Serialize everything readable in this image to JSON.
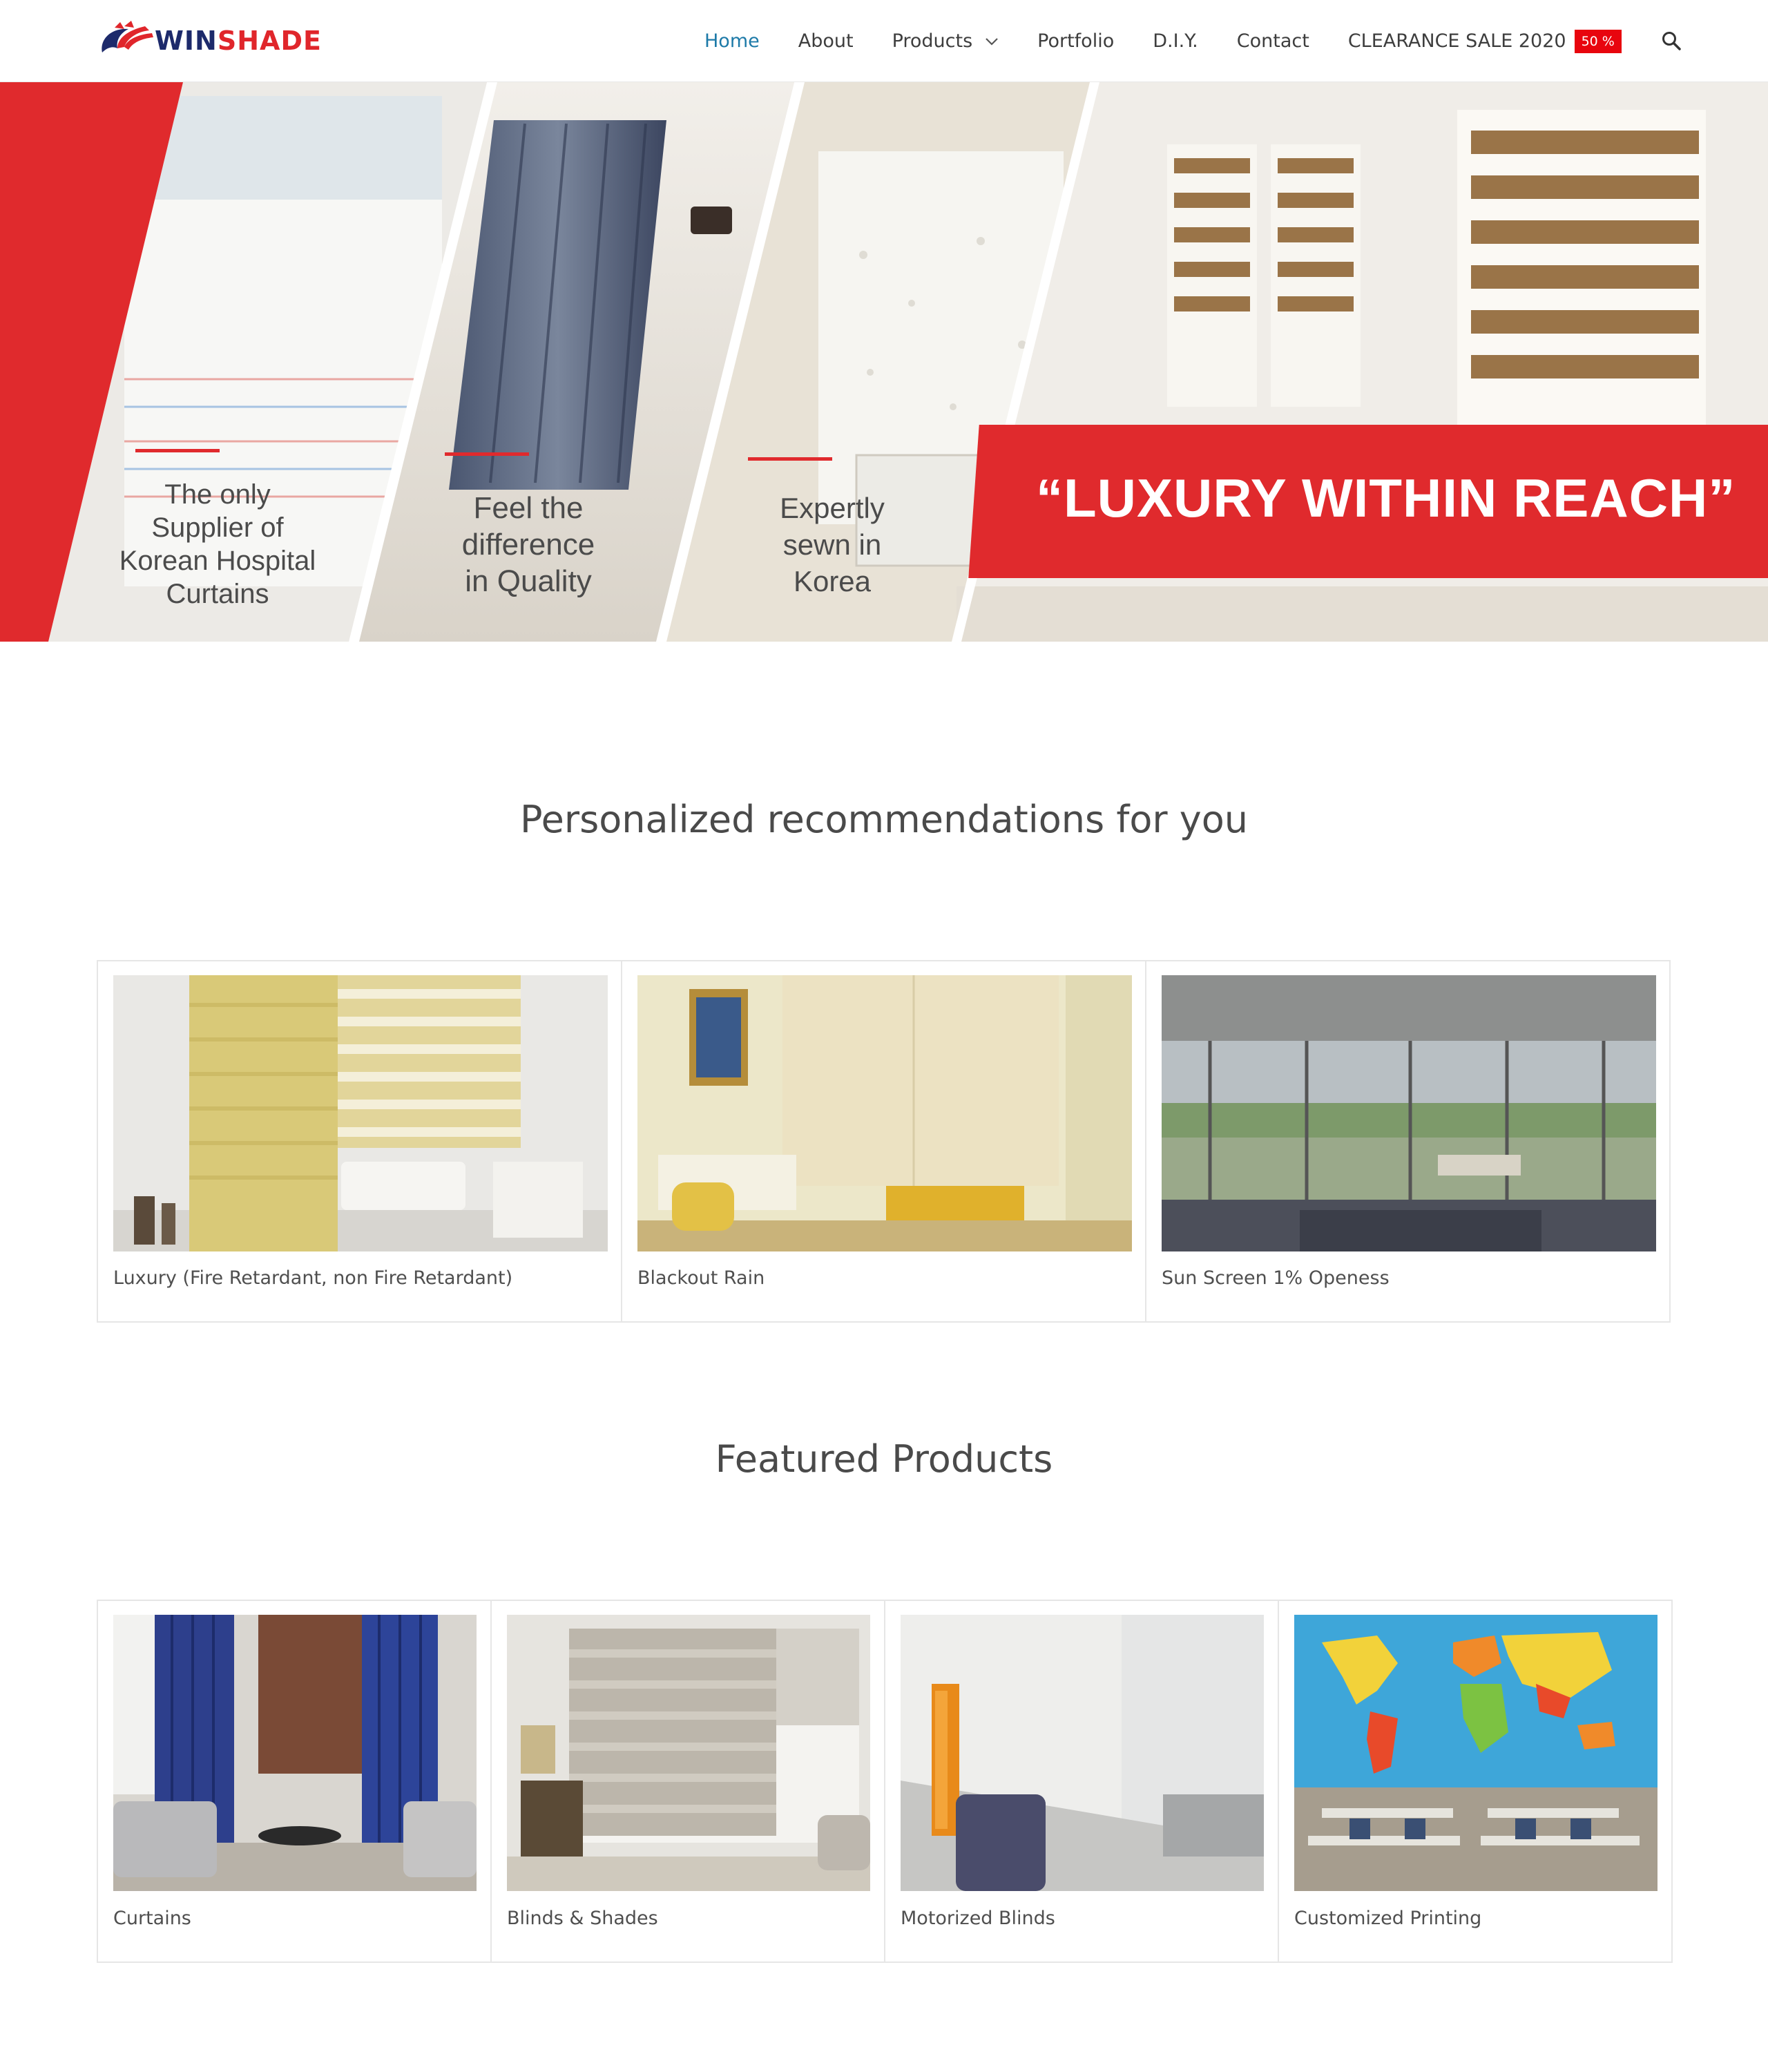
{
  "brand": {
    "name_part1": "WIN",
    "name_part2": "SHADE"
  },
  "nav": {
    "items": [
      {
        "label": "Home",
        "active": true
      },
      {
        "label": "About"
      },
      {
        "label": "Products",
        "has_dropdown": true
      },
      {
        "label": "Portfolio"
      },
      {
        "label": "D.I.Y."
      },
      {
        "label": "Contact"
      },
      {
        "label": "CLEARANCE SALE 2020",
        "badge": "50 %"
      }
    ],
    "search_icon": "search-icon"
  },
  "hero": {
    "captions": [
      "The only Supplier of Korean Hospital Curtains",
      "Feel the difference in Quality",
      "Expertly sewn in Korea"
    ],
    "banner": "“LUXURY WITHIN REACH”",
    "accent_color": "#e02a2d"
  },
  "recommendations": {
    "title": "Personalized recommendations for you",
    "items": [
      {
        "label": "Luxury (Fire Retardant, non Fire Retardant)"
      },
      {
        "label": "Blackout Rain"
      },
      {
        "label": "Sun Screen 1% Openess"
      }
    ]
  },
  "featured": {
    "title": "Featured Products",
    "items": [
      {
        "label": "Curtains"
      },
      {
        "label": "Blinds & Shades"
      },
      {
        "label": "Motorized Blinds"
      },
      {
        "label": "Customized Printing"
      }
    ]
  },
  "colors": {
    "nav_active": "#1d7aa8",
    "badge": "#e8050e",
    "brand_blue": "#1d2a6b",
    "brand_red": "#e0262b"
  }
}
